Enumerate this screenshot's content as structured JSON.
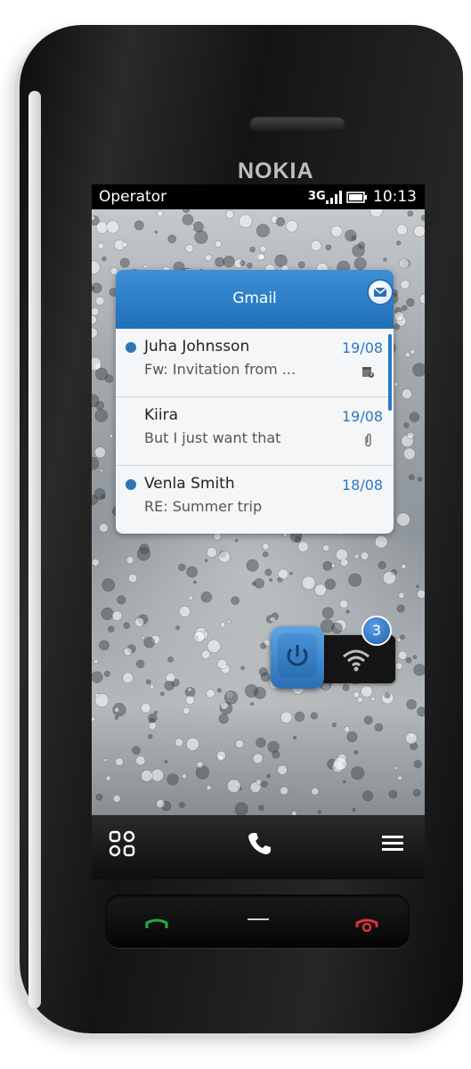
{
  "device": {
    "brand": "NOKIA"
  },
  "statusbar": {
    "operator": "Operator",
    "network": "3G",
    "time": "10:13"
  },
  "gmail": {
    "title": "Gmail",
    "messages": [
      {
        "sender": "Juha Johnsson",
        "subject": "Fw: Invitation from ...",
        "date": "19/08",
        "unread": true,
        "icon": "calendar-invite-icon"
      },
      {
        "sender": "Kiira",
        "subject": "But I just want that",
        "date": "19/08",
        "unread": false,
        "icon": "paperclip-icon"
      },
      {
        "sender": "Venla Smith",
        "subject": "RE: Summer trip",
        "date": "18/08",
        "unread": true,
        "icon": ""
      }
    ]
  },
  "connectivity": {
    "count": "3"
  },
  "colors": {
    "accent": "#2c78c4",
    "header": "#1e6fb8",
    "call": "#1fae3f",
    "end": "#e0323a"
  }
}
